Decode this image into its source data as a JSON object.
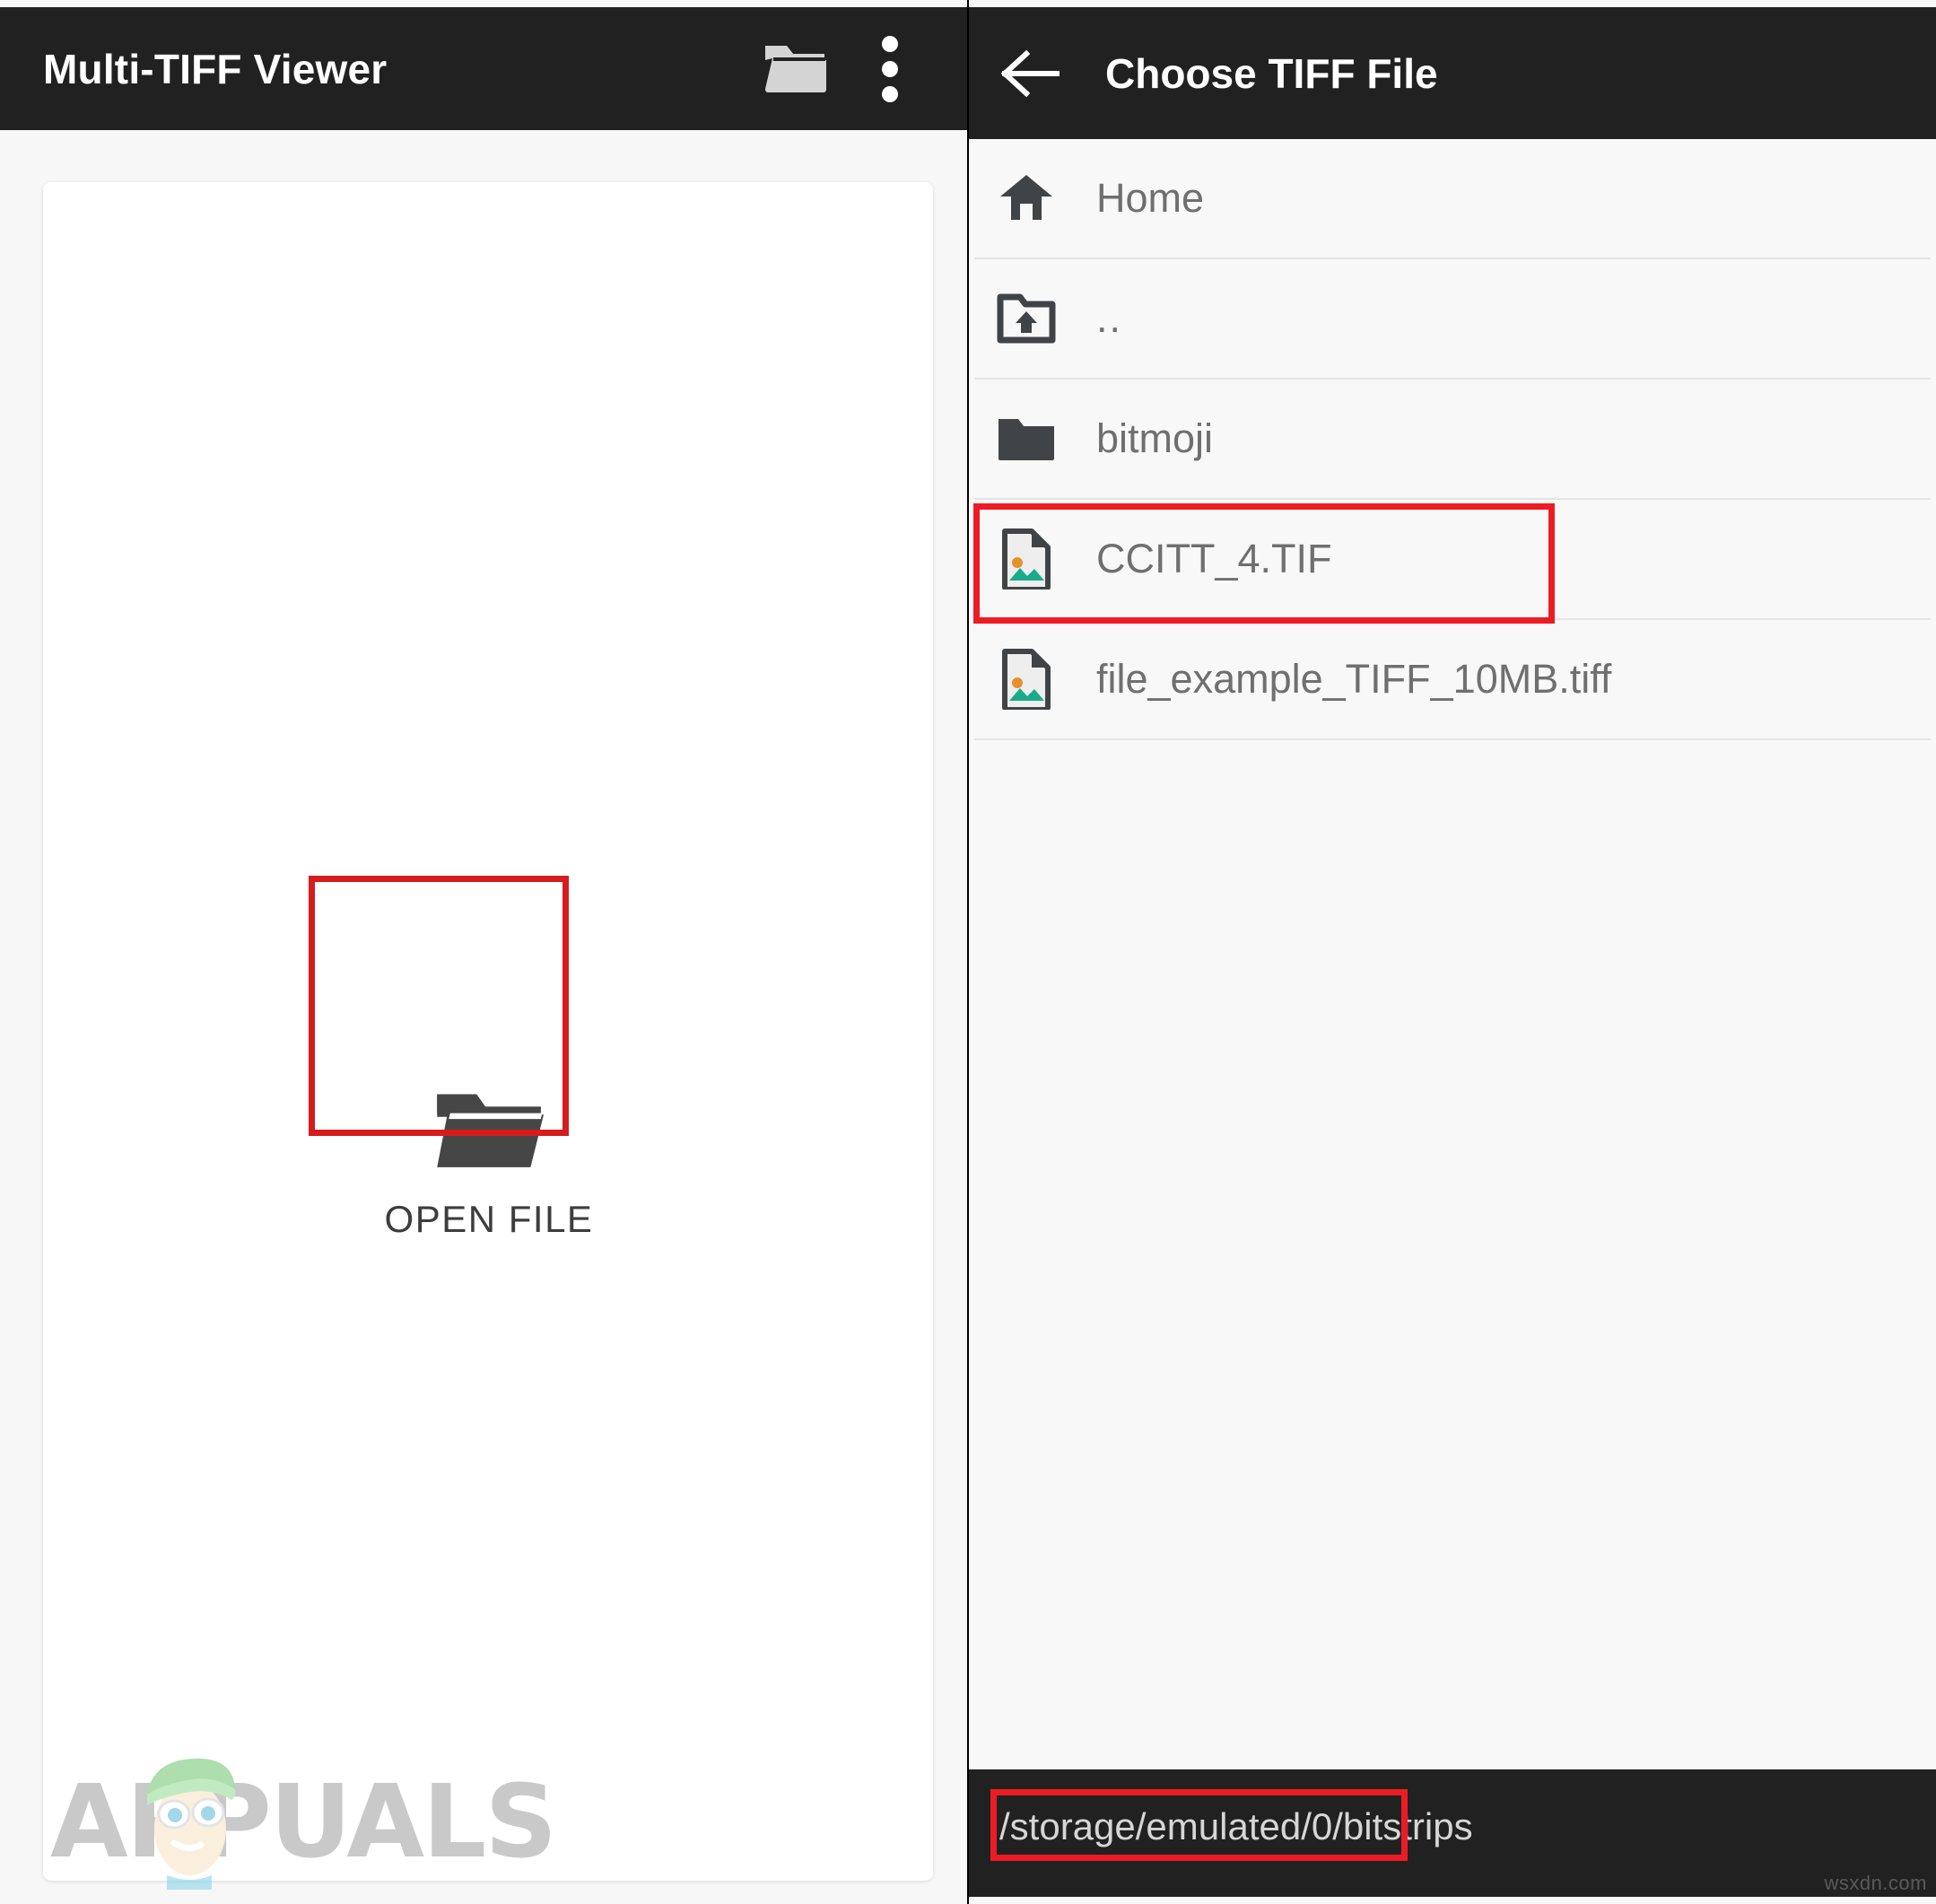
{
  "left_panel": {
    "appbar": {
      "title": "Multi-TIFF Viewer",
      "folder_icon": "folder-open-icon",
      "overflow_icon": "more-vertical-icon"
    },
    "open_file_button": {
      "label": "OPEN FILE",
      "icon": "folder-open-icon"
    },
    "watermark": "APPUALS"
  },
  "right_panel": {
    "appbar": {
      "back_icon": "arrow-left-icon",
      "title": "Choose TIFF File"
    },
    "file_list": [
      {
        "label": "Home",
        "icon": "home-icon",
        "type": "shortcut"
      },
      {
        "label": "..",
        "icon": "folder-up-icon",
        "type": "parent"
      },
      {
        "label": "bitmoji",
        "icon": "folder-icon",
        "type": "folder"
      },
      {
        "label": "CCITT_4.TIF",
        "icon": "image-file-icon",
        "type": "file"
      },
      {
        "label": "file_example_TIFF_10MB.tiff",
        "icon": "image-file-icon",
        "type": "file"
      }
    ],
    "path_bar": {
      "path": "/storage/emulated/0/bitstrips"
    },
    "watermark": "wsxdn.com"
  },
  "annotations": {
    "highlight_color": "#ed1c24",
    "boxes": [
      {
        "target": "open-file-button"
      },
      {
        "target": "file-row-ccitt"
      },
      {
        "target": "path-text"
      }
    ]
  },
  "colors": {
    "appbar_bg": "#212121",
    "panel_bg": "#f8f8f8",
    "card_bg": "#ffffff",
    "icon_dark": "#3f4143",
    "label_gray": "#6f6f6f",
    "image_icon_sun": "#e8902a",
    "image_icon_hill": "#1aab8a"
  }
}
